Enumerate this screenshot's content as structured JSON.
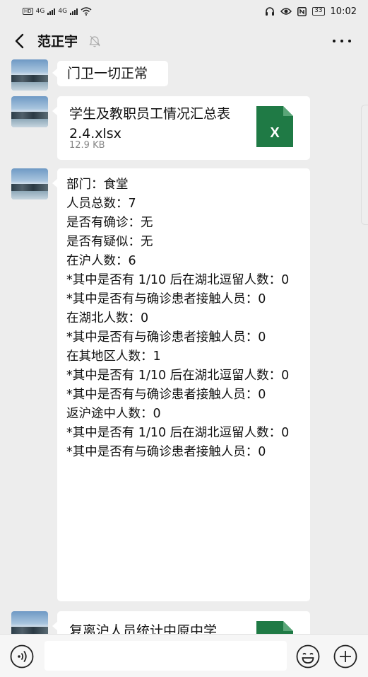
{
  "status_bar": {
    "left_hd1": "HD",
    "left_4g1": "4G",
    "left_4g2": "4G",
    "battery": "33",
    "time": "10:02"
  },
  "header": {
    "title": "范正宇",
    "back_icon": "chevron-left-icon",
    "mute_icon": "mute-icon",
    "more_icon": "more-icon"
  },
  "messages": {
    "msg1_text": "门卫一切正常",
    "file1": {
      "name": "学生及教职员工情况汇总表 2.4.xlsx",
      "size": "12.9 KB",
      "icon_letter": "X"
    },
    "long_msg_text": "部门：食堂\n人员总数：7\n是否有确诊：无\n是否有疑似：无\n在沪人数：6\n*其中是否有 1/10 后在湖北逗留人数：0\n*其中是否有与确诊患者接触人员：0\n在湖北人数：0\n*其中是否有与确诊患者接触人员：0\n在其地区人数：1\n*其中是否有 1/10 后在湖北逗留人数：0\n*其中是否有与确诊患者接触人员：0\n返沪途中人数：0\n*其中是否有 1/10 后在湖北逗留人数：0\n*其中是否有与确诊患者接触人员：0",
    "file2": {
      "name": "复离沪人员统计中原中学",
      "icon_letter": "X"
    }
  },
  "input_bar": {
    "voice_icon": "voice-icon",
    "emoji_icon": "emoji-icon",
    "plus_icon": "plus-icon",
    "input_value": ""
  },
  "colors": {
    "background": "#ededed",
    "bubble": "#ffffff",
    "excel_green": "#1f7a45"
  }
}
